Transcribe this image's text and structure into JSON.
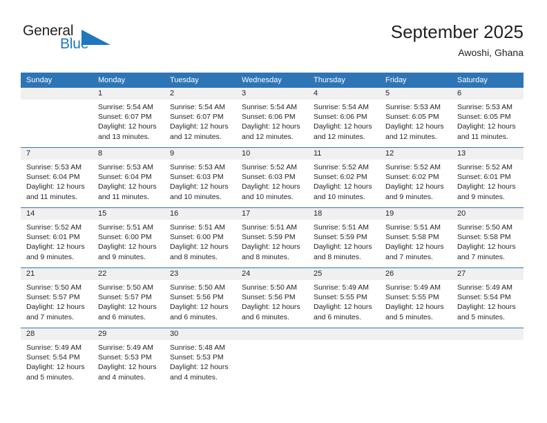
{
  "logo": {
    "text_general": "General",
    "text_blue": "Blue",
    "icon": "triangle-logo-icon",
    "color_blue": "#1f77bc",
    "color_dark": "#231f20"
  },
  "header": {
    "title": "September 2025",
    "subtitle": "Awoshi, Ghana"
  },
  "theme": {
    "header_blue": "#2e75b6",
    "band_gray": "#f0f0f0",
    "text": "#231f20"
  },
  "weekday_headers": [
    "Sunday",
    "Monday",
    "Tuesday",
    "Wednesday",
    "Thursday",
    "Friday",
    "Saturday"
  ],
  "weeks": [
    [
      {
        "day": "",
        "sunrise": "",
        "sunset": "",
        "daylight1": "",
        "daylight2": "",
        "empty": true
      },
      {
        "day": "1",
        "sunrise": "Sunrise: 5:54 AM",
        "sunset": "Sunset: 6:07 PM",
        "daylight1": "Daylight: 12 hours",
        "daylight2": "and 13 minutes."
      },
      {
        "day": "2",
        "sunrise": "Sunrise: 5:54 AM",
        "sunset": "Sunset: 6:07 PM",
        "daylight1": "Daylight: 12 hours",
        "daylight2": "and 12 minutes."
      },
      {
        "day": "3",
        "sunrise": "Sunrise: 5:54 AM",
        "sunset": "Sunset: 6:06 PM",
        "daylight1": "Daylight: 12 hours",
        "daylight2": "and 12 minutes."
      },
      {
        "day": "4",
        "sunrise": "Sunrise: 5:54 AM",
        "sunset": "Sunset: 6:06 PM",
        "daylight1": "Daylight: 12 hours",
        "daylight2": "and 12 minutes."
      },
      {
        "day": "5",
        "sunrise": "Sunrise: 5:53 AM",
        "sunset": "Sunset: 6:05 PM",
        "daylight1": "Daylight: 12 hours",
        "daylight2": "and 12 minutes."
      },
      {
        "day": "6",
        "sunrise": "Sunrise: 5:53 AM",
        "sunset": "Sunset: 6:05 PM",
        "daylight1": "Daylight: 12 hours",
        "daylight2": "and 11 minutes."
      }
    ],
    [
      {
        "day": "7",
        "sunrise": "Sunrise: 5:53 AM",
        "sunset": "Sunset: 6:04 PM",
        "daylight1": "Daylight: 12 hours",
        "daylight2": "and 11 minutes."
      },
      {
        "day": "8",
        "sunrise": "Sunrise: 5:53 AM",
        "sunset": "Sunset: 6:04 PM",
        "daylight1": "Daylight: 12 hours",
        "daylight2": "and 11 minutes."
      },
      {
        "day": "9",
        "sunrise": "Sunrise: 5:53 AM",
        "sunset": "Sunset: 6:03 PM",
        "daylight1": "Daylight: 12 hours",
        "daylight2": "and 10 minutes."
      },
      {
        "day": "10",
        "sunrise": "Sunrise: 5:52 AM",
        "sunset": "Sunset: 6:03 PM",
        "daylight1": "Daylight: 12 hours",
        "daylight2": "and 10 minutes."
      },
      {
        "day": "11",
        "sunrise": "Sunrise: 5:52 AM",
        "sunset": "Sunset: 6:02 PM",
        "daylight1": "Daylight: 12 hours",
        "daylight2": "and 10 minutes."
      },
      {
        "day": "12",
        "sunrise": "Sunrise: 5:52 AM",
        "sunset": "Sunset: 6:02 PM",
        "daylight1": "Daylight: 12 hours",
        "daylight2": "and 9 minutes."
      },
      {
        "day": "13",
        "sunrise": "Sunrise: 5:52 AM",
        "sunset": "Sunset: 6:01 PM",
        "daylight1": "Daylight: 12 hours",
        "daylight2": "and 9 minutes."
      }
    ],
    [
      {
        "day": "14",
        "sunrise": "Sunrise: 5:52 AM",
        "sunset": "Sunset: 6:01 PM",
        "daylight1": "Daylight: 12 hours",
        "daylight2": "and 9 minutes."
      },
      {
        "day": "15",
        "sunrise": "Sunrise: 5:51 AM",
        "sunset": "Sunset: 6:00 PM",
        "daylight1": "Daylight: 12 hours",
        "daylight2": "and 9 minutes."
      },
      {
        "day": "16",
        "sunrise": "Sunrise: 5:51 AM",
        "sunset": "Sunset: 6:00 PM",
        "daylight1": "Daylight: 12 hours",
        "daylight2": "and 8 minutes."
      },
      {
        "day": "17",
        "sunrise": "Sunrise: 5:51 AM",
        "sunset": "Sunset: 5:59 PM",
        "daylight1": "Daylight: 12 hours",
        "daylight2": "and 8 minutes."
      },
      {
        "day": "18",
        "sunrise": "Sunrise: 5:51 AM",
        "sunset": "Sunset: 5:59 PM",
        "daylight1": "Daylight: 12 hours",
        "daylight2": "and 8 minutes."
      },
      {
        "day": "19",
        "sunrise": "Sunrise: 5:51 AM",
        "sunset": "Sunset: 5:58 PM",
        "daylight1": "Daylight: 12 hours",
        "daylight2": "and 7 minutes."
      },
      {
        "day": "20",
        "sunrise": "Sunrise: 5:50 AM",
        "sunset": "Sunset: 5:58 PM",
        "daylight1": "Daylight: 12 hours",
        "daylight2": "and 7 minutes."
      }
    ],
    [
      {
        "day": "21",
        "sunrise": "Sunrise: 5:50 AM",
        "sunset": "Sunset: 5:57 PM",
        "daylight1": "Daylight: 12 hours",
        "daylight2": "and 7 minutes."
      },
      {
        "day": "22",
        "sunrise": "Sunrise: 5:50 AM",
        "sunset": "Sunset: 5:57 PM",
        "daylight1": "Daylight: 12 hours",
        "daylight2": "and 6 minutes."
      },
      {
        "day": "23",
        "sunrise": "Sunrise: 5:50 AM",
        "sunset": "Sunset: 5:56 PM",
        "daylight1": "Daylight: 12 hours",
        "daylight2": "and 6 minutes."
      },
      {
        "day": "24",
        "sunrise": "Sunrise: 5:50 AM",
        "sunset": "Sunset: 5:56 PM",
        "daylight1": "Daylight: 12 hours",
        "daylight2": "and 6 minutes."
      },
      {
        "day": "25",
        "sunrise": "Sunrise: 5:49 AM",
        "sunset": "Sunset: 5:55 PM",
        "daylight1": "Daylight: 12 hours",
        "daylight2": "and 6 minutes."
      },
      {
        "day": "26",
        "sunrise": "Sunrise: 5:49 AM",
        "sunset": "Sunset: 5:55 PM",
        "daylight1": "Daylight: 12 hours",
        "daylight2": "and 5 minutes."
      },
      {
        "day": "27",
        "sunrise": "Sunrise: 5:49 AM",
        "sunset": "Sunset: 5:54 PM",
        "daylight1": "Daylight: 12 hours",
        "daylight2": "and 5 minutes."
      }
    ],
    [
      {
        "day": "28",
        "sunrise": "Sunrise: 5:49 AM",
        "sunset": "Sunset: 5:54 PM",
        "daylight1": "Daylight: 12 hours",
        "daylight2": "and 5 minutes."
      },
      {
        "day": "29",
        "sunrise": "Sunrise: 5:49 AM",
        "sunset": "Sunset: 5:53 PM",
        "daylight1": "Daylight: 12 hours",
        "daylight2": "and 4 minutes."
      },
      {
        "day": "30",
        "sunrise": "Sunrise: 5:48 AM",
        "sunset": "Sunset: 5:53 PM",
        "daylight1": "Daylight: 12 hours",
        "daylight2": "and 4 minutes."
      },
      {
        "day": "",
        "sunrise": "",
        "sunset": "",
        "daylight1": "",
        "daylight2": "",
        "empty": true
      },
      {
        "day": "",
        "sunrise": "",
        "sunset": "",
        "daylight1": "",
        "daylight2": "",
        "empty": true
      },
      {
        "day": "",
        "sunrise": "",
        "sunset": "",
        "daylight1": "",
        "daylight2": "",
        "empty": true
      },
      {
        "day": "",
        "sunrise": "",
        "sunset": "",
        "daylight1": "",
        "daylight2": "",
        "empty": true
      }
    ]
  ]
}
